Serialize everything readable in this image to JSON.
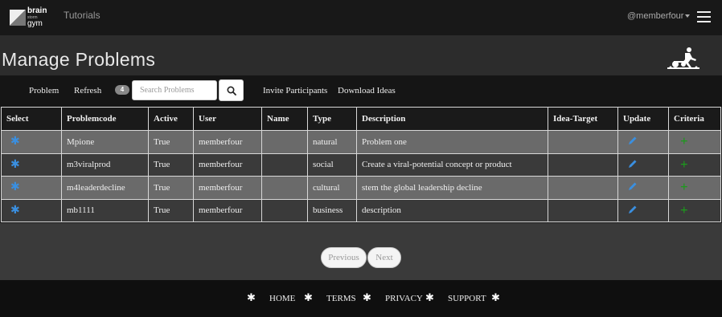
{
  "brand": {
    "line1": "brain",
    "line2": "storm",
    "line3": "gym",
    "logo_icon": "brainstorm-gym-logo"
  },
  "nav": {
    "tutorials": "Tutorials",
    "user": "@memberfour",
    "menu_icon": "hamburger-icon"
  },
  "page": {
    "title": "Manage Problems",
    "hero_icon": "gym-athlete-icon"
  },
  "toolbar": {
    "problem": "Problem",
    "refresh": "Refresh",
    "count": "4",
    "search_placeholder": "Search Problems",
    "search_icon": "search-icon",
    "invite": "Invite Participants",
    "download": "Download Ideas"
  },
  "table": {
    "headers": [
      "Select",
      "Problemcode",
      "Active",
      "User",
      "Name",
      "Type",
      "Description",
      "Idea-Target",
      "Update",
      "Criteria"
    ],
    "rows": [
      {
        "problemcode": "Mpione",
        "active": "True",
        "user": "memberfour",
        "name": "",
        "type": "natural",
        "description": "Problem one",
        "idea_target": ""
      },
      {
        "problemcode": "m3viralprod",
        "active": "True",
        "user": "memberfour",
        "name": "",
        "type": "social",
        "description": "Create a viral-potential concept or product",
        "idea_target": ""
      },
      {
        "problemcode": "m4leaderdecline",
        "active": "True",
        "user": "memberfour",
        "name": "",
        "type": "cultural",
        "description": "stem the global leadership decline",
        "idea_target": ""
      },
      {
        "problemcode": "mb1111",
        "active": "True",
        "user": "memberfour",
        "name": "",
        "type": "business",
        "description": "description",
        "idea_target": ""
      }
    ],
    "select_icon": "asterisk-icon",
    "update_icon": "pencil-icon",
    "criteria_icon": "plus-icon"
  },
  "pager": {
    "previous": "Previous",
    "next": "Next"
  },
  "footer": {
    "home": "HOME",
    "terms": "TERMS",
    "privacy": "PRIVACY",
    "support": "SUPPORT"
  },
  "colors": {
    "select_icon": "#3a8fe0",
    "criteria_icon": "#1c9a1c",
    "row_odd": "#6a6a6a",
    "row_even": "#3a3a3a"
  }
}
